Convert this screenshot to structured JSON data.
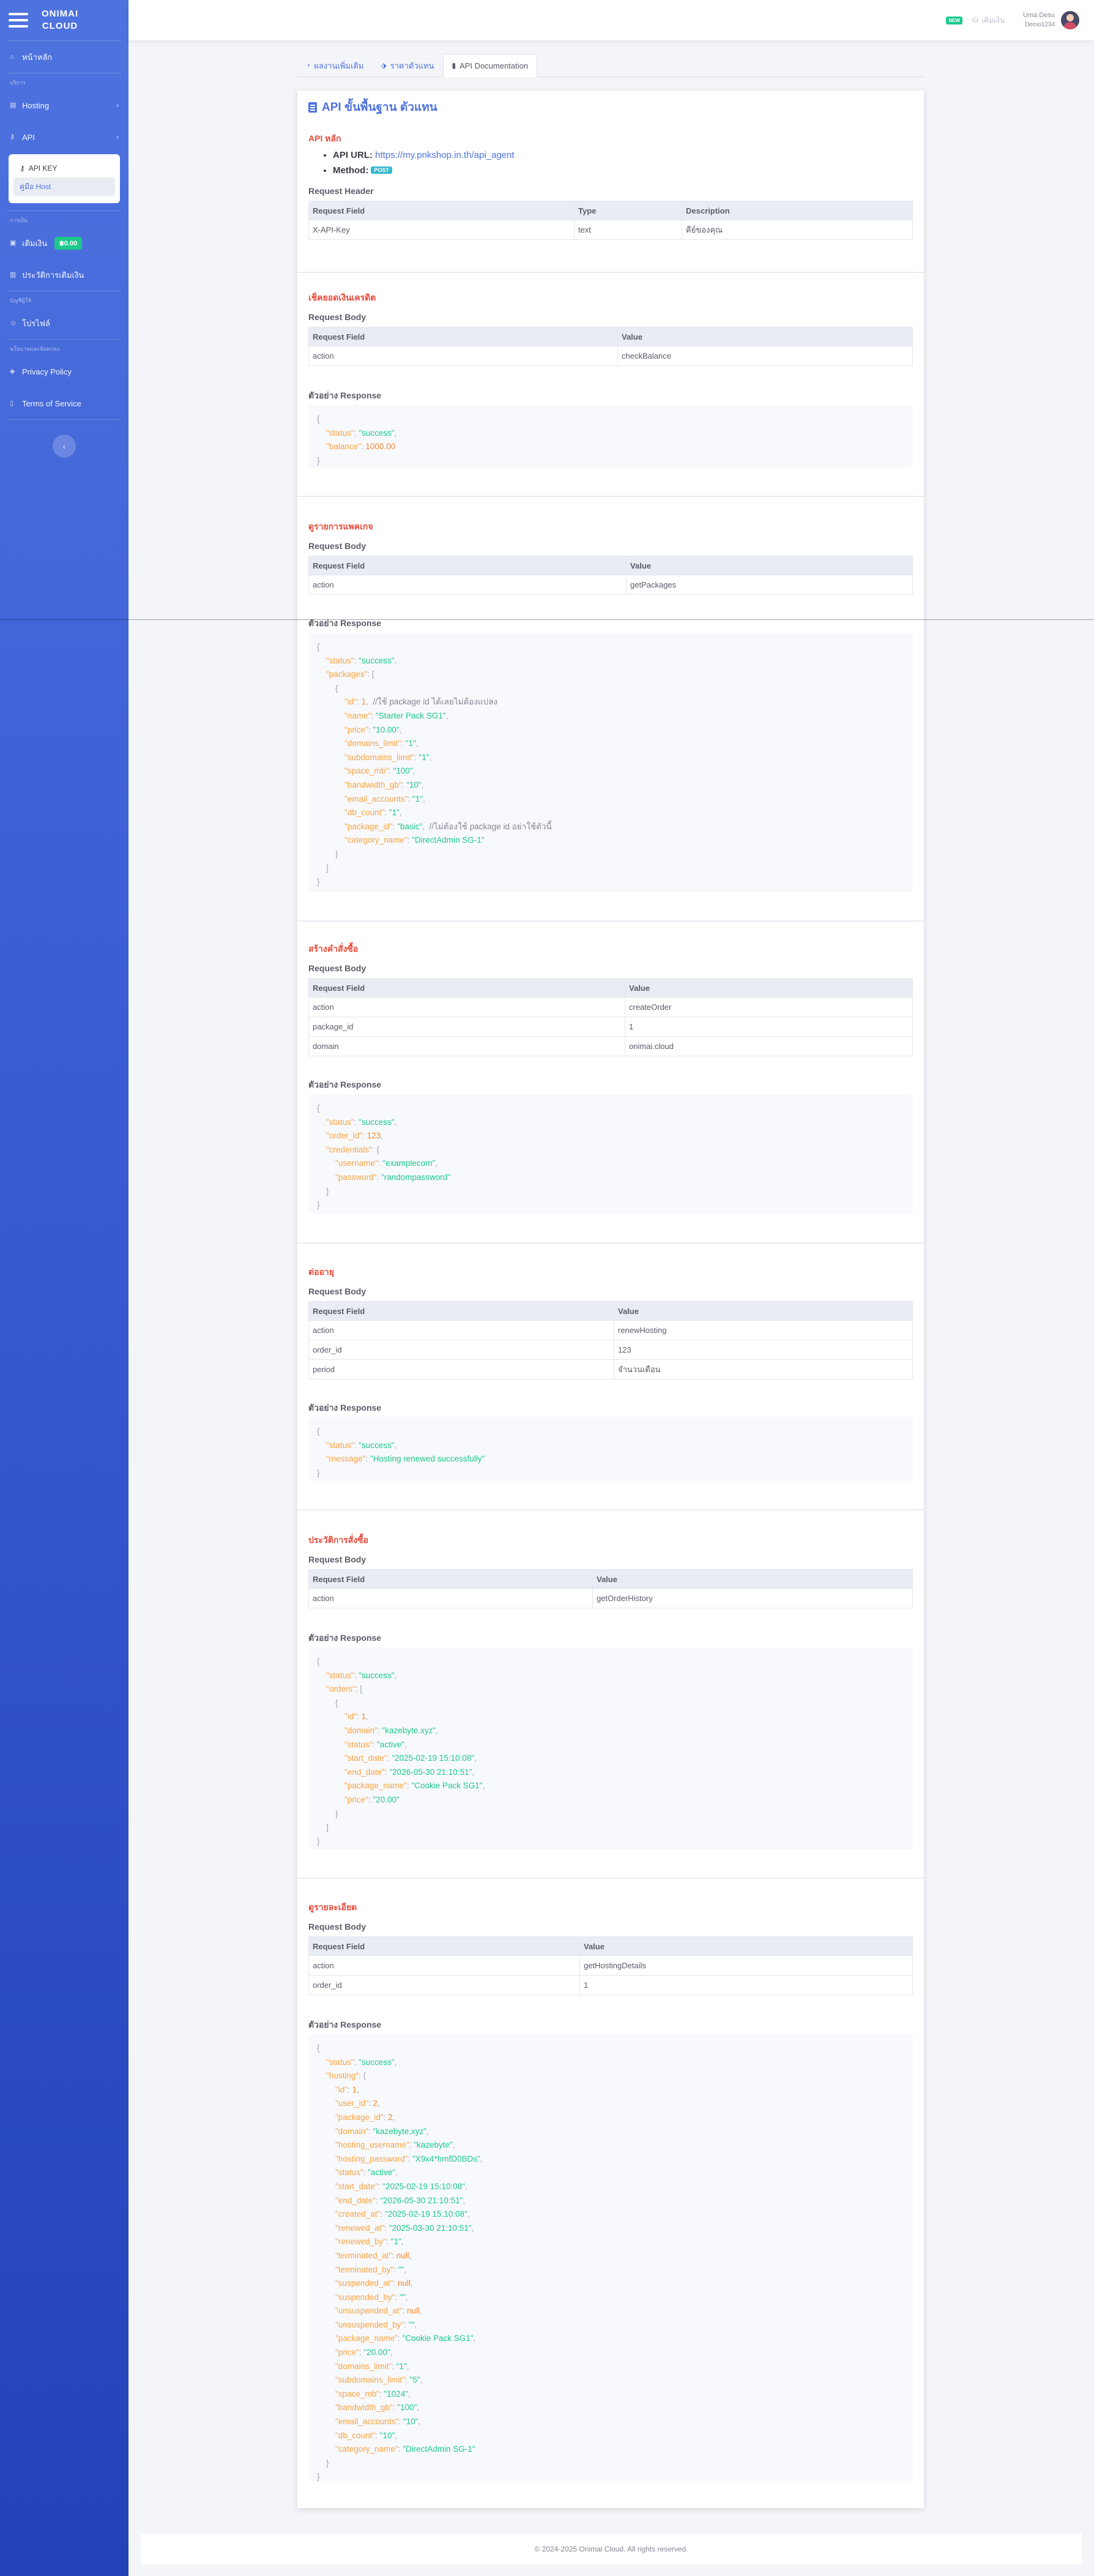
{
  "brand": {
    "name_line1": "ONIMAI",
    "name_line2": "CLOUD"
  },
  "sidebar": {
    "home": "หน้าหลัก",
    "heading_services": "บริการ",
    "hosting": "Hosting",
    "api": "API",
    "api_sub": [
      {
        "label": "API KEY"
      },
      {
        "label": "คู่มือ Host"
      }
    ],
    "heading_finance": "การเงิน",
    "topup": "เติมเงิน",
    "balance": "฿0.00",
    "topup_history": "ประวัติการเติมเงิน",
    "heading_account": "บัญชีผู้ใช้",
    "profile": "โปรไฟล์",
    "heading_policy": "นโยบายและข้อตกลง",
    "privacy": "Privacy Policy",
    "terms": "Terms of Service",
    "collapse": "‹"
  },
  "topbar": {
    "new_badge": "NEW",
    "topup_link": "เติมเงิน",
    "user_name": "Uma Desu",
    "user_role": "Demo1234"
  },
  "tabs": [
    {
      "label": "ผลงานเพิ่มเติม",
      "icon": "tachometer-icon"
    },
    {
      "label": "ราคาตัวแทน",
      "icon": "tags-icon"
    },
    {
      "label": "API Documentation",
      "icon": "book-icon"
    }
  ],
  "doc": {
    "title": "API ขั้นพื้นฐาน ตัวแทน",
    "main": {
      "title": "API หลัก",
      "url_label": "API URL:",
      "url": "https://my.pnkshop.in.th/api_agent",
      "method_label": "Method:",
      "method": "POST",
      "header_label": "Request Header",
      "header_cols": [
        "Request Field",
        "Type",
        "Description"
      ],
      "header_rows": [
        [
          "X-API-Key",
          "text",
          "คีย์ของคุณ"
        ]
      ]
    },
    "balance": {
      "title": "เช็คยอดเงินเครดิต",
      "body_label": "Request Body",
      "cols": [
        "Request Field",
        "Value"
      ],
      "rows": [
        [
          "action",
          "checkBalance"
        ]
      ],
      "resp_label": "ตัวอย่าง Response"
    },
    "packages": {
      "title": "ดูรายการแพคเกจ",
      "body_label": "Request Body",
      "cols": [
        "Request Field",
        "Value"
      ],
      "rows": [
        [
          "action",
          "getPackages"
        ]
      ],
      "resp_label": "ตัวอย่าง Response"
    },
    "order": {
      "title": "สร้างคำสั่งซื้อ",
      "body_label": "Request Body",
      "cols": [
        "Request Field",
        "Value"
      ],
      "rows": [
        [
          "action",
          "createOrder"
        ],
        [
          "package_id",
          "1"
        ],
        [
          "domain",
          "onimai.cloud"
        ]
      ],
      "resp_label": "ตัวอย่าง Response"
    },
    "renew": {
      "title": "ต่ออายุ",
      "body_label": "Request Body",
      "cols": [
        "Request Field",
        "Value"
      ],
      "rows": [
        [
          "action",
          "renewHosting"
        ],
        [
          "order_id",
          "123"
        ],
        [
          "period",
          "จำนวนเดือน"
        ]
      ],
      "resp_label": "ตัวอย่าง Response"
    },
    "history": {
      "title": "ประวัติการสั่งซื้อ",
      "body_label": "Request Body",
      "cols": [
        "Request Field",
        "Value"
      ],
      "rows": [
        [
          "action",
          "getOrderHistory"
        ]
      ],
      "resp_label": "ตัวอย่าง Response"
    },
    "details": {
      "title": "ดูรายละเอียด",
      "body_label": "Request Body",
      "cols": [
        "Request Field",
        "Value"
      ],
      "rows": [
        [
          "action",
          "getHostingDetails"
        ],
        [
          "order_id",
          "1"
        ]
      ],
      "resp_label": "ตัวอย่าง Response"
    }
  },
  "footer": "© 2024-2025 Onimai Cloud. All rights reserved."
}
